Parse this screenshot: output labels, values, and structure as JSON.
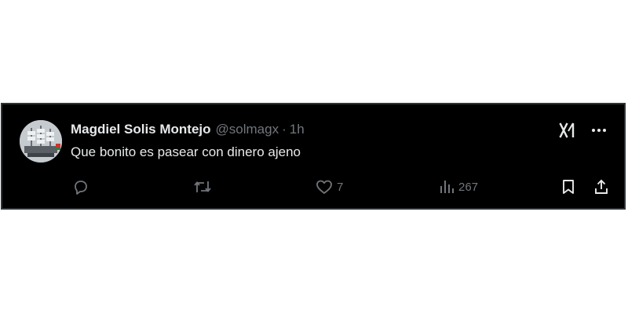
{
  "tweet": {
    "author_name": "Magdiel Solis Montejo",
    "handle": "@solmagx",
    "separator": "·",
    "time": "1h",
    "text": "Que bonito es pasear con dinero ajeno",
    "avatar_icon": "ship-avatar-icon"
  },
  "actions": {
    "reply_count": "",
    "retweet_count": "",
    "like_count": "7",
    "views_count": "267"
  },
  "icons": {
    "grok": "grok-icon",
    "more": "more-icon",
    "reply": "reply-icon",
    "retweet": "retweet-icon",
    "like": "heart-icon",
    "views": "analytics-icon",
    "bookmark": "bookmark-icon",
    "share": "share-icon"
  },
  "colors": {
    "background": "#000000",
    "text_primary": "#e7e9ea",
    "text_secondary": "#71767b",
    "border": "#2f3336"
  }
}
